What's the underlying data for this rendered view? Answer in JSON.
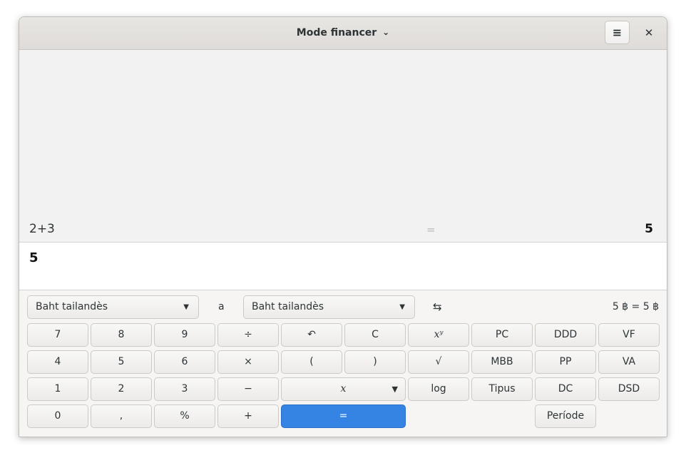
{
  "header": {
    "title": "Mode financer",
    "title_chevron_icon": "chevron-down-icon",
    "menu_icon": "hamburger-menu-icon",
    "menu_glyph": "≡",
    "close_glyph": "✕"
  },
  "history": {
    "expression": "2+3",
    "equals": "=",
    "result": "5"
  },
  "entry": {
    "value": "5"
  },
  "converter": {
    "from_currency": "Baht tailandès",
    "connector": "a",
    "to_currency": "Baht tailandès",
    "swap_glyph": "⇆",
    "result": "5 ฿  =  5 ฿"
  },
  "keypad": {
    "row1": [
      "7",
      "8",
      "9",
      "÷",
      "↶",
      "C",
      "xʸ",
      "PC",
      "DDD",
      "VF"
    ],
    "row2": [
      "4",
      "5",
      "6",
      "×",
      "(",
      ")",
      "√",
      "MBB",
      "PP",
      "VA"
    ],
    "row3": [
      "1",
      "2",
      "3",
      "−",
      "x",
      "log",
      "Tipus",
      "DC",
      "DSD"
    ],
    "row4": [
      "0",
      ",",
      "%",
      "+",
      "=",
      "Període"
    ]
  },
  "colors": {
    "accent": "#3584e4"
  }
}
